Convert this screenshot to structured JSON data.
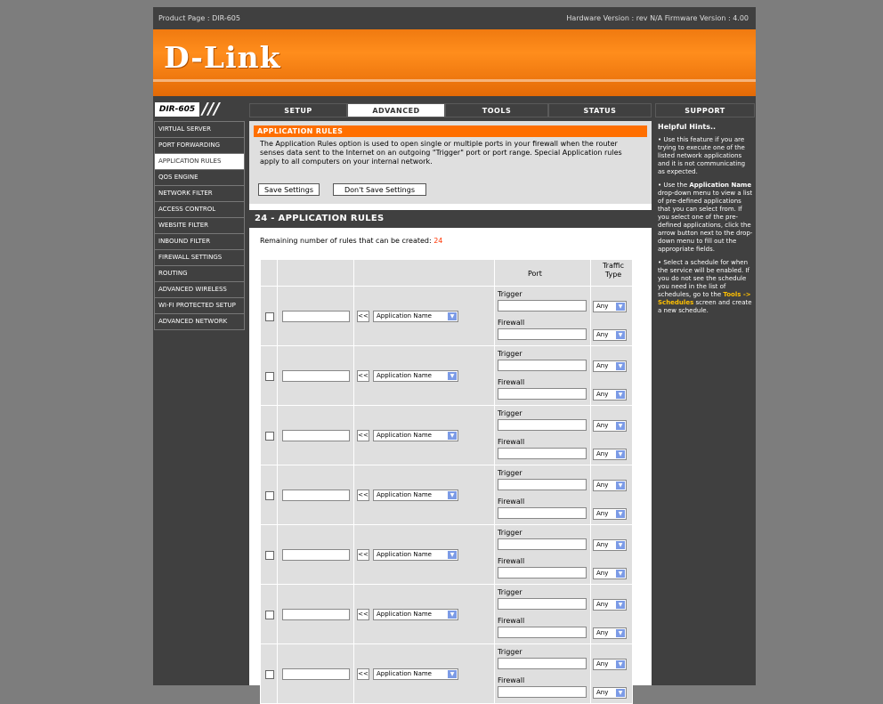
{
  "topbar": {
    "product_page": "Product Page : DIR-605",
    "versions": "Hardware Version : rev N/A   Firmware Version : 4.00"
  },
  "banner": {
    "logo": "D-Link"
  },
  "nav": {
    "model": "DIR-605",
    "slashes": "///",
    "tabs": [
      "SETUP",
      "ADVANCED",
      "TOOLS",
      "STATUS",
      "SUPPORT"
    ],
    "active_tab": "ADVANCED"
  },
  "sidebar": {
    "items": [
      {
        "label": "VIRTUAL SERVER"
      },
      {
        "label": "PORT FORWARDING"
      },
      {
        "label": "APPLICATION RULES"
      },
      {
        "label": "QOS ENGINE"
      },
      {
        "label": "NETWORK FILTER"
      },
      {
        "label": "ACCESS CONTROL"
      },
      {
        "label": "WEBSITE FILTER"
      },
      {
        "label": "INBOUND FILTER"
      },
      {
        "label": "FIREWALL SETTINGS"
      },
      {
        "label": "ROUTING"
      },
      {
        "label": "ADVANCED WIRELESS"
      },
      {
        "label": "WI-FI PROTECTED SETUP"
      },
      {
        "label": "ADVANCED NETWORK"
      }
    ],
    "active": "APPLICATION RULES"
  },
  "intro": {
    "title": "APPLICATION RULES",
    "text": "The Application Rules option is used to open single or multiple ports in your firewall when the router senses data sent to the Internet on an outgoing \"Trigger\" port or port range. Special Application rules apply to all computers on your internal network.",
    "save_label": "Save Settings",
    "dont_save_label": "Don't Save Settings"
  },
  "rules": {
    "header": "24 - APPLICATION RULES",
    "remaining_label": "Remaining number of rules that can be created:",
    "remaining_count": "24",
    "col_port": "Port",
    "col_traffic": "Traffic Type",
    "trigger_label": "Trigger",
    "firewall_label": "Firewall",
    "arrow_label": "<<",
    "app_select": "Application Name",
    "traffic_value": "Any"
  },
  "hints": {
    "title": "Helpful Hints..",
    "h1": "Use this feature if you are trying to execute one of the listed network applications and it is not communicating as expected.",
    "h2_pre": "Use the ",
    "h2_bold": "Application Name",
    "h2_post": " drop-down menu to view a list of pre-defined applications that you can select from. If you select one of the pre-defined applications, click the arrow button next to the drop-down menu to fill out the appropriate fields.",
    "h3_pre": "Select a schedule for when the service will be enabled. If you do not see the schedule you need in the list of schedules, go to the ",
    "h3_link": "Tools -> Schedules",
    "h3_post": " screen and create a new schedule."
  },
  "colors": {
    "orange": "#ff6f00",
    "dark": "#404040",
    "gray_panel": "#dfdfdf",
    "remaining": "#ff3300",
    "hint_link": "#ffc000"
  }
}
